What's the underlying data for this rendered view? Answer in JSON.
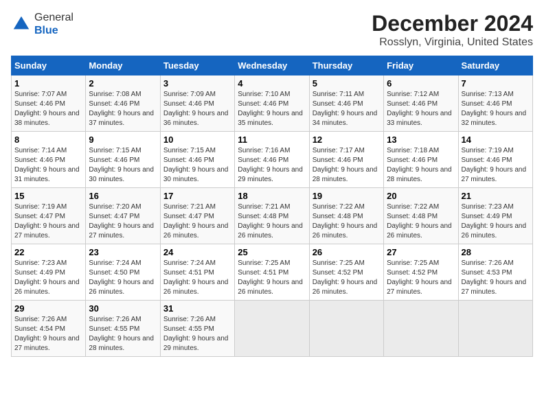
{
  "header": {
    "logo_line1": "General",
    "logo_line2": "Blue",
    "title": "December 2024",
    "subtitle": "Rosslyn, Virginia, United States"
  },
  "days_of_week": [
    "Sunday",
    "Monday",
    "Tuesday",
    "Wednesday",
    "Thursday",
    "Friday",
    "Saturday"
  ],
  "weeks": [
    [
      {
        "day": "1",
        "sunrise": "7:07 AM",
        "sunset": "4:46 PM",
        "daylight": "9 hours and 38 minutes."
      },
      {
        "day": "2",
        "sunrise": "7:08 AM",
        "sunset": "4:46 PM",
        "daylight": "9 hours and 37 minutes."
      },
      {
        "day": "3",
        "sunrise": "7:09 AM",
        "sunset": "4:46 PM",
        "daylight": "9 hours and 36 minutes."
      },
      {
        "day": "4",
        "sunrise": "7:10 AM",
        "sunset": "4:46 PM",
        "daylight": "9 hours and 35 minutes."
      },
      {
        "day": "5",
        "sunrise": "7:11 AM",
        "sunset": "4:46 PM",
        "daylight": "9 hours and 34 minutes."
      },
      {
        "day": "6",
        "sunrise": "7:12 AM",
        "sunset": "4:46 PM",
        "daylight": "9 hours and 33 minutes."
      },
      {
        "day": "7",
        "sunrise": "7:13 AM",
        "sunset": "4:46 PM",
        "daylight": "9 hours and 32 minutes."
      }
    ],
    [
      {
        "day": "8",
        "sunrise": "7:14 AM",
        "sunset": "4:46 PM",
        "daylight": "9 hours and 31 minutes."
      },
      {
        "day": "9",
        "sunrise": "7:15 AM",
        "sunset": "4:46 PM",
        "daylight": "9 hours and 30 minutes."
      },
      {
        "day": "10",
        "sunrise": "7:15 AM",
        "sunset": "4:46 PM",
        "daylight": "9 hours and 30 minutes."
      },
      {
        "day": "11",
        "sunrise": "7:16 AM",
        "sunset": "4:46 PM",
        "daylight": "9 hours and 29 minutes."
      },
      {
        "day": "12",
        "sunrise": "7:17 AM",
        "sunset": "4:46 PM",
        "daylight": "9 hours and 28 minutes."
      },
      {
        "day": "13",
        "sunrise": "7:18 AM",
        "sunset": "4:46 PM",
        "daylight": "9 hours and 28 minutes."
      },
      {
        "day": "14",
        "sunrise": "7:19 AM",
        "sunset": "4:46 PM",
        "daylight": "9 hours and 27 minutes."
      }
    ],
    [
      {
        "day": "15",
        "sunrise": "7:19 AM",
        "sunset": "4:47 PM",
        "daylight": "9 hours and 27 minutes."
      },
      {
        "day": "16",
        "sunrise": "7:20 AM",
        "sunset": "4:47 PM",
        "daylight": "9 hours and 27 minutes."
      },
      {
        "day": "17",
        "sunrise": "7:21 AM",
        "sunset": "4:47 PM",
        "daylight": "9 hours and 26 minutes."
      },
      {
        "day": "18",
        "sunrise": "7:21 AM",
        "sunset": "4:48 PM",
        "daylight": "9 hours and 26 minutes."
      },
      {
        "day": "19",
        "sunrise": "7:22 AM",
        "sunset": "4:48 PM",
        "daylight": "9 hours and 26 minutes."
      },
      {
        "day": "20",
        "sunrise": "7:22 AM",
        "sunset": "4:48 PM",
        "daylight": "9 hours and 26 minutes."
      },
      {
        "day": "21",
        "sunrise": "7:23 AM",
        "sunset": "4:49 PM",
        "daylight": "9 hours and 26 minutes."
      }
    ],
    [
      {
        "day": "22",
        "sunrise": "7:23 AM",
        "sunset": "4:49 PM",
        "daylight": "9 hours and 26 minutes."
      },
      {
        "day": "23",
        "sunrise": "7:24 AM",
        "sunset": "4:50 PM",
        "daylight": "9 hours and 26 minutes."
      },
      {
        "day": "24",
        "sunrise": "7:24 AM",
        "sunset": "4:51 PM",
        "daylight": "9 hours and 26 minutes."
      },
      {
        "day": "25",
        "sunrise": "7:25 AM",
        "sunset": "4:51 PM",
        "daylight": "9 hours and 26 minutes."
      },
      {
        "day": "26",
        "sunrise": "7:25 AM",
        "sunset": "4:52 PM",
        "daylight": "9 hours and 26 minutes."
      },
      {
        "day": "27",
        "sunrise": "7:25 AM",
        "sunset": "4:52 PM",
        "daylight": "9 hours and 27 minutes."
      },
      {
        "day": "28",
        "sunrise": "7:26 AM",
        "sunset": "4:53 PM",
        "daylight": "9 hours and 27 minutes."
      }
    ],
    [
      {
        "day": "29",
        "sunrise": "7:26 AM",
        "sunset": "4:54 PM",
        "daylight": "9 hours and 27 minutes."
      },
      {
        "day": "30",
        "sunrise": "7:26 AM",
        "sunset": "4:55 PM",
        "daylight": "9 hours and 28 minutes."
      },
      {
        "day": "31",
        "sunrise": "7:26 AM",
        "sunset": "4:55 PM",
        "daylight": "9 hours and 29 minutes."
      },
      null,
      null,
      null,
      null
    ]
  ]
}
